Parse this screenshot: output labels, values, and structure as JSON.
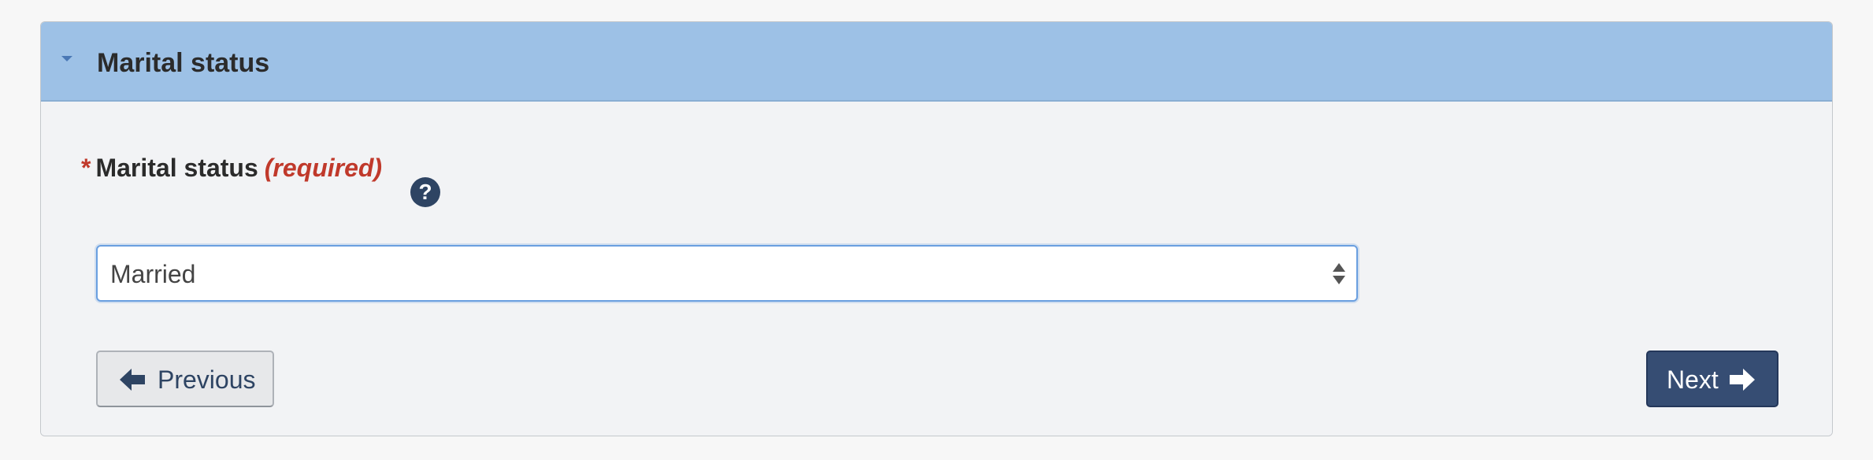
{
  "panel": {
    "title": "Marital status",
    "collapse_icon": "caret-down-icon"
  },
  "field": {
    "required_marker": "*",
    "label": "Marital status",
    "required_text": "(required)",
    "help_icon": "question-circle-icon",
    "help_glyph": "?",
    "selected_value": "Married"
  },
  "buttons": {
    "previous_label": "Previous",
    "previous_icon": "arrow-left-icon",
    "next_label": "Next",
    "next_icon": "arrow-right-icon"
  },
  "colors": {
    "header_bg": "#9dc1e6",
    "required": "#c0392b",
    "primary_button": "#364d73",
    "help_icon": "#2e4463"
  }
}
